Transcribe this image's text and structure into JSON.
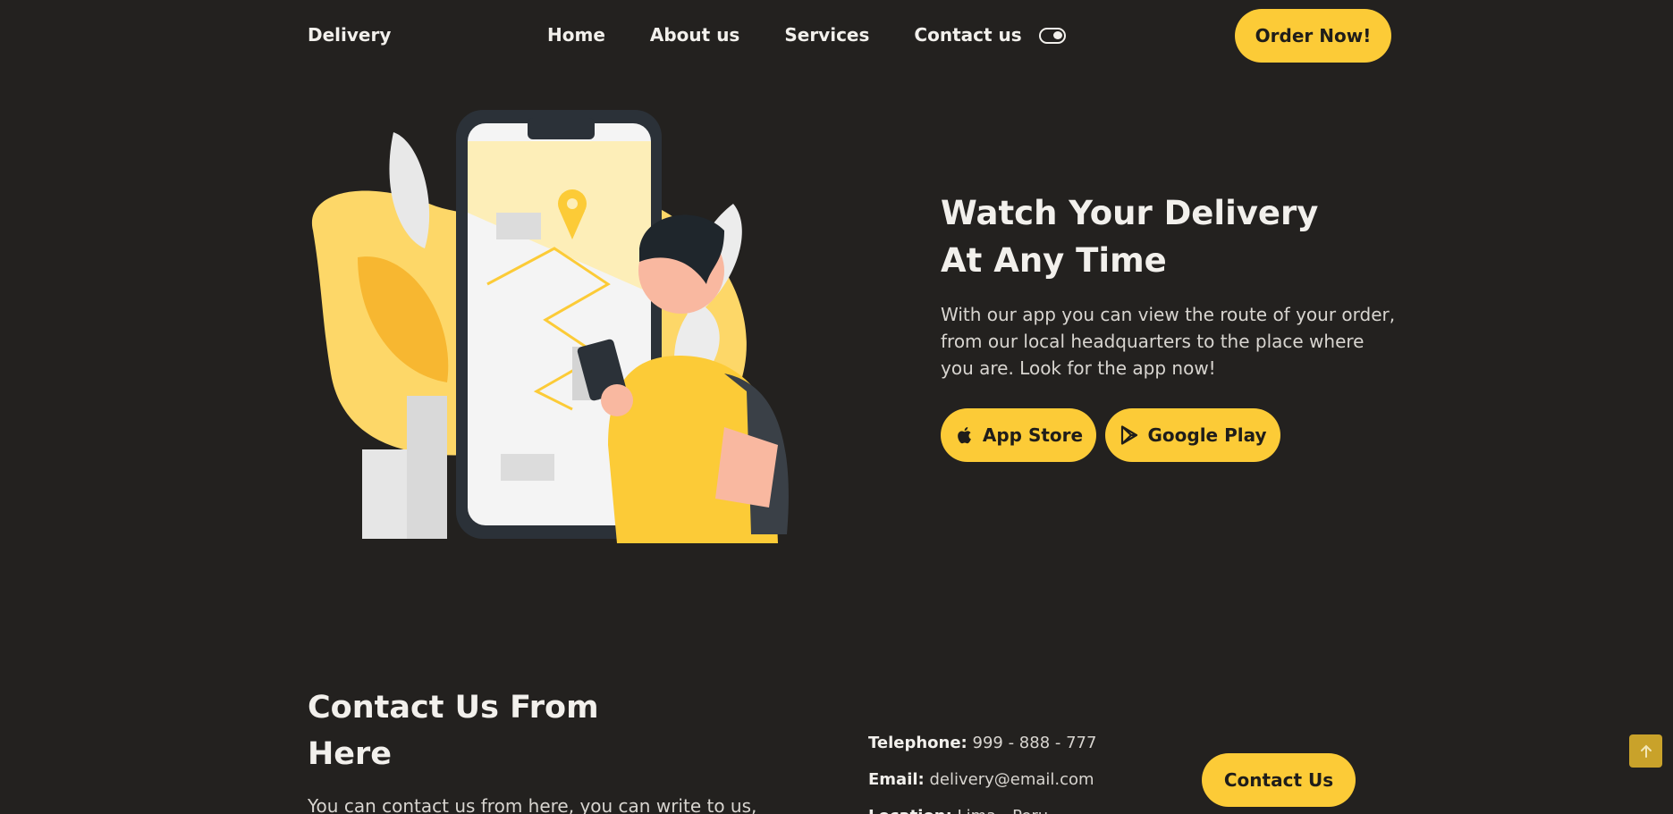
{
  "header": {
    "logo": "Delivery",
    "nav": [
      "Home",
      "About us",
      "Services",
      "Contact us"
    ],
    "order_button": "Order Now!"
  },
  "hero": {
    "title_line1": "Watch Your Delivery",
    "title_line2": "At Any Time",
    "text": "With our app you can view the route of your order, from our local headquarters to the place where you are. Look for the app now!",
    "app_store": "App Store",
    "google_play": "Google Play"
  },
  "contact": {
    "title_line1": "Contact Us From",
    "title_line2": "Here",
    "text": "You can contact us from here, you can write to us,",
    "telephone_label": "Telephone:",
    "telephone": "999 - 888 - 777",
    "email_label": "Email:",
    "email": "delivery@email.com",
    "location_label": "Location:",
    "location": "Lima - Peru",
    "button": "Contact Us"
  },
  "colors": {
    "background": "#23211f",
    "accent": "#fccb37",
    "text": "#f2f0ec"
  },
  "icons": [
    "toggle-icon",
    "apple-icon",
    "google-play-icon",
    "arrow-up-icon"
  ]
}
